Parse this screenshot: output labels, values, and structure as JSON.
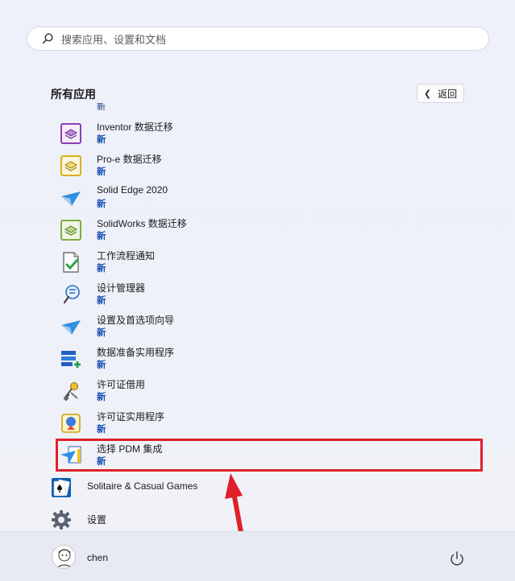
{
  "search": {
    "placeholder": "搜索应用、设置和文档",
    "icon": "search-icon"
  },
  "header": {
    "title": "所有应用",
    "back_label": "返回"
  },
  "list": {
    "cut_label": "新",
    "items": [
      {
        "name": "Inventor 数据迁移",
        "badge": "新",
        "icon": "inventor-migration-icon"
      },
      {
        "name": "Pro-e 数据迁移",
        "badge": "新",
        "icon": "proe-migration-icon"
      },
      {
        "name": "Solid Edge 2020",
        "badge": "新",
        "icon": "solid-edge-icon"
      },
      {
        "name": "SolidWorks 数据迁移",
        "badge": "新",
        "icon": "solidworks-migration-icon"
      },
      {
        "name": "工作流程通知",
        "badge": "新",
        "icon": "workflow-notify-icon"
      },
      {
        "name": "设计管理器",
        "badge": "新",
        "icon": "design-manager-icon"
      },
      {
        "name": "设置及首选项向导",
        "badge": "新",
        "icon": "settings-wizard-icon"
      },
      {
        "name": "数据准备实用程序",
        "badge": "新",
        "icon": "data-prep-icon"
      },
      {
        "name": "许可证借用",
        "badge": "新",
        "icon": "license-borrow-icon"
      },
      {
        "name": "许可证实用程序",
        "badge": "新",
        "icon": "license-utility-icon"
      },
      {
        "name": "选择 PDM 集成",
        "badge": "新",
        "icon": "pdm-integration-icon"
      },
      {
        "name": "Solitaire & Casual Games",
        "icon": "solitaire-icon"
      },
      {
        "name": "设置",
        "icon": "gear-icon"
      }
    ]
  },
  "user": {
    "name": "chen",
    "avatar": "avatar"
  },
  "power": {
    "icon": "power-icon"
  },
  "colors": {
    "highlight": "#e0202a",
    "badge": "#1a4fb0"
  }
}
